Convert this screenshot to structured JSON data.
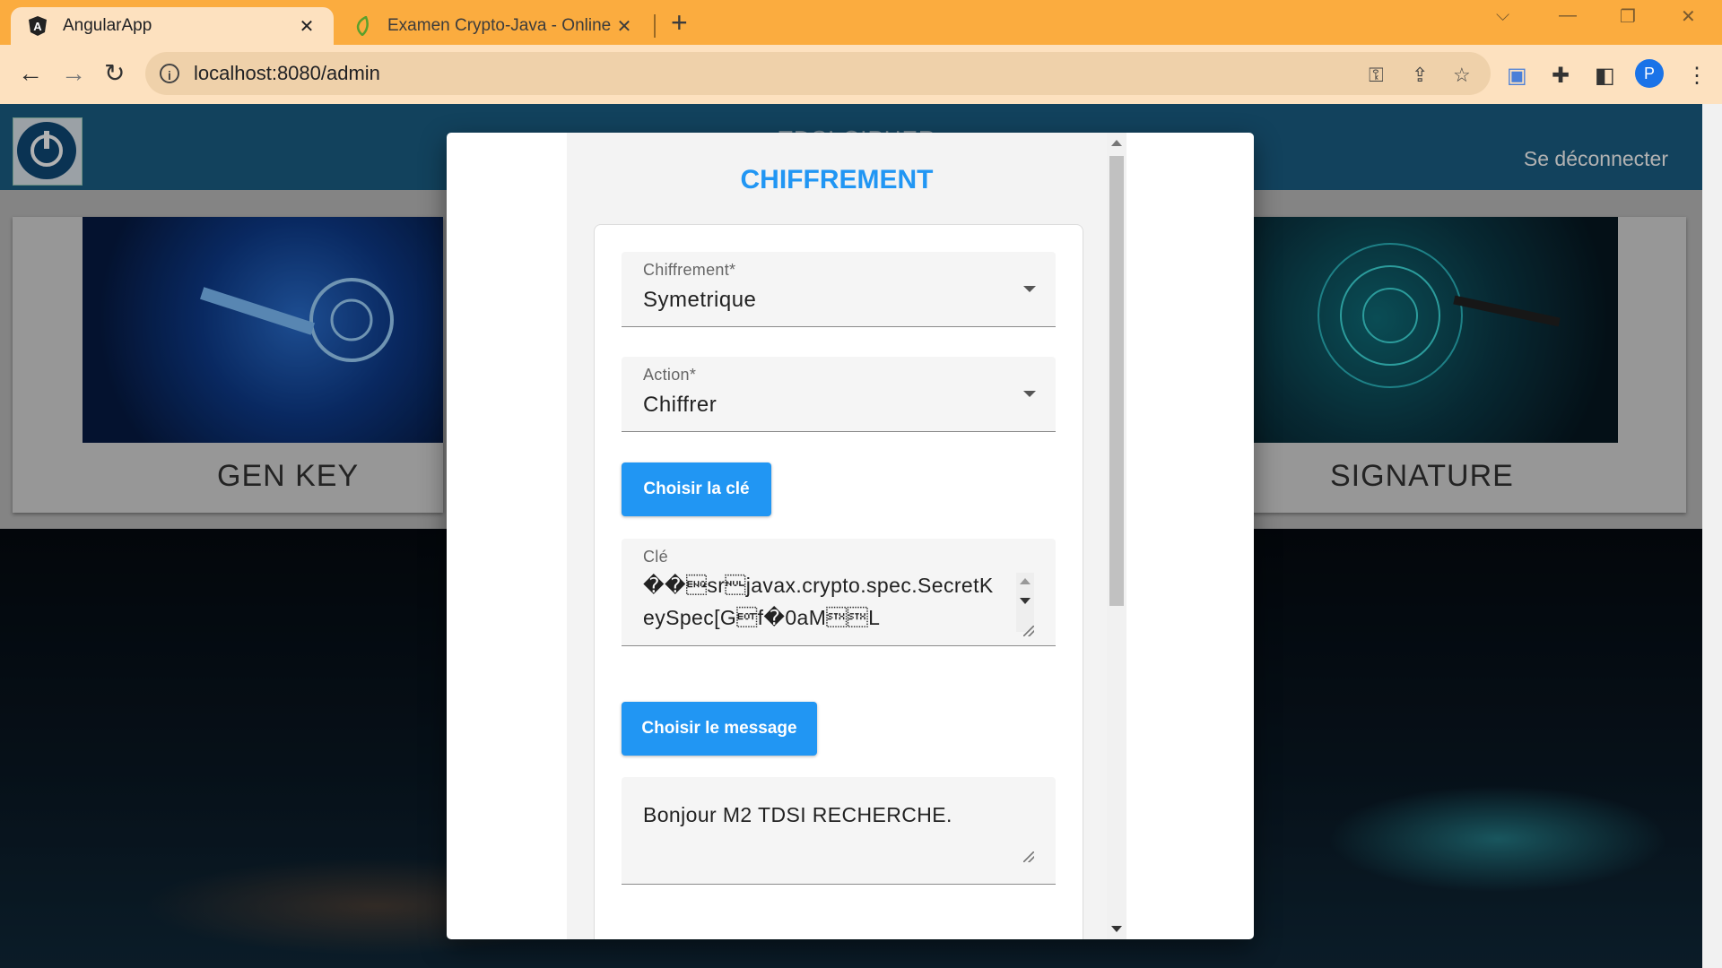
{
  "browser": {
    "tabs": [
      {
        "title": "AngularApp",
        "icon": "angular-icon",
        "active": true
      },
      {
        "title": "Examen Crypto-Java - Online La",
        "icon": "leaf-icon",
        "active": false
      }
    ],
    "url": "localhost:8080/admin",
    "profile_initial": "P",
    "colors": {
      "tabbar": "#fbac3f",
      "toolbar": "#fde1bf"
    }
  },
  "app": {
    "title": "TDSI CIPHER",
    "logout_label": "Se déconnecter",
    "cards": [
      {
        "label": "GEN KEY"
      },
      {
        "label": "SIGNATURE"
      }
    ],
    "colors": {
      "header": "#1b5f86",
      "accent": "#2196f3"
    }
  },
  "dialog": {
    "title": "CHIFFREMENT",
    "cipher_field": {
      "label": "Chiffrement*",
      "value": "Symetrique"
    },
    "action_field": {
      "label": "Action*",
      "value": "Chiffrer"
    },
    "choose_key_button": "Choisir la clé",
    "key_field": {
      "label": "Clé",
      "value": "��\u0005sr\u0000javax.crypto.spec.SecretKeySpec[G\u0004f�0aM\u0002\u0002L"
    },
    "choose_message_button": "Choisir le message",
    "message_field": {
      "value": "Bonjour M2 TDSI RECHERCHE."
    }
  }
}
